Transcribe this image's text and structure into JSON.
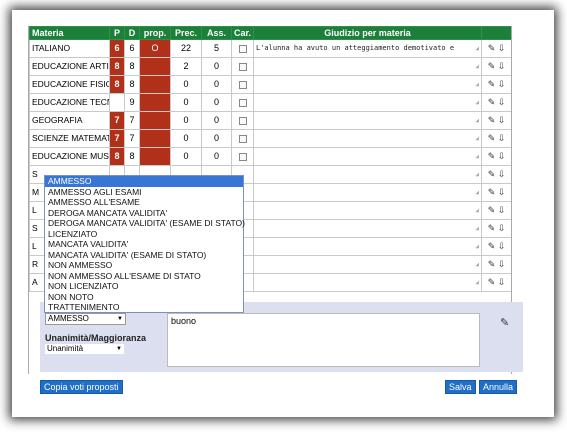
{
  "headers": [
    "Materia",
    "P",
    "D",
    "prop.",
    "Prec.",
    "Ass.",
    "Car.",
    "Giudizio per materia"
  ],
  "rows": [
    {
      "subject": "ITALIANO",
      "p": "6",
      "d": "6",
      "prop": "O",
      "prec": "22",
      "ass": "5",
      "judgement": "L'alunna ha avuto un atteggiamento demotivato e"
    },
    {
      "subject": "EDUCAZIONE ARTISTICA",
      "p": "8",
      "d": "8",
      "prop": "",
      "prec": "2",
      "ass": "0",
      "judgement": ""
    },
    {
      "subject": "EDUCAZIONE FISICA",
      "p": "8",
      "d": "8",
      "prop": "",
      "prec": "0",
      "ass": "0",
      "judgement": ""
    },
    {
      "subject": "EDUCAZIONE TECNICA",
      "p": "",
      "d": "9",
      "prop": "",
      "prec": "0",
      "ass": "0",
      "judgement": ""
    },
    {
      "subject": "GEOGRAFIA",
      "p": "7",
      "d": "7",
      "prop": "",
      "prec": "0",
      "ass": "0",
      "judgement": ""
    },
    {
      "subject": "SCIENZE MATEMATICHE",
      "p": "7",
      "d": "7",
      "prop": "",
      "prec": "0",
      "ass": "0",
      "judgement": ""
    },
    {
      "subject": "EDUCAZIONE MUSICALE",
      "p": "8",
      "d": "8",
      "prop": "",
      "prec": "0",
      "ass": "0",
      "judgement": ""
    },
    {
      "subject": "S",
      "p": "",
      "d": "",
      "prop": "",
      "prec": "",
      "ass": "",
      "judgement": ""
    },
    {
      "subject": "M",
      "p": "",
      "d": "",
      "prop": "",
      "prec": "",
      "ass": "",
      "judgement": ""
    },
    {
      "subject": "L",
      "p": "",
      "d": "",
      "prop": "",
      "prec": "",
      "ass": "",
      "judgement": ""
    },
    {
      "subject": "S",
      "p": "",
      "d": "",
      "prop": "",
      "prec": "",
      "ass": "",
      "judgement": ""
    },
    {
      "subject": "L",
      "p": "",
      "d": "",
      "prop": "",
      "prec": "",
      "ass": "",
      "judgement": ""
    },
    {
      "subject": "R",
      "p": "",
      "d": "",
      "prop": "",
      "prec": "",
      "ass": "",
      "judgement": ""
    },
    {
      "subject": "A",
      "p": "",
      "d": "",
      "prop": "",
      "prec": "",
      "ass": "--",
      "judgement": ""
    }
  ],
  "dropdown": {
    "options": [
      "AMMESSO",
      "AMMESSO AGLI ESAMI",
      "AMMESSO ALL'ESAME",
      "DEROGA MANCATA VALIDITA'",
      "DEROGA MANCATA VALIDITA' (ESAME DI STATO)",
      "LICENZIATO",
      "MANCATA VALIDITA'",
      "MANCATA VALIDITA' (ESAME DI STATO)",
      "NON AMMESSO",
      "NON AMMESSO ALL'ESAME DI STATO",
      "NON LICENZIATO",
      "NON NOTO",
      "TRATTENIMENTO"
    ],
    "selected": "AMMESSO"
  },
  "esito_value": "AMMESSO",
  "unanimita_label": "Unanimità/Maggioranza",
  "unanimita_value": "Unanimità",
  "giudizio_text": "buono",
  "buttons": {
    "copy": "Copia voti proposti",
    "save": "Salva",
    "cancel": "Annulla"
  },
  "colors": {
    "header": "#1c7f3a",
    "grade": "#b0301a",
    "button": "#1f6fc7",
    "selection": "#3876d6"
  }
}
